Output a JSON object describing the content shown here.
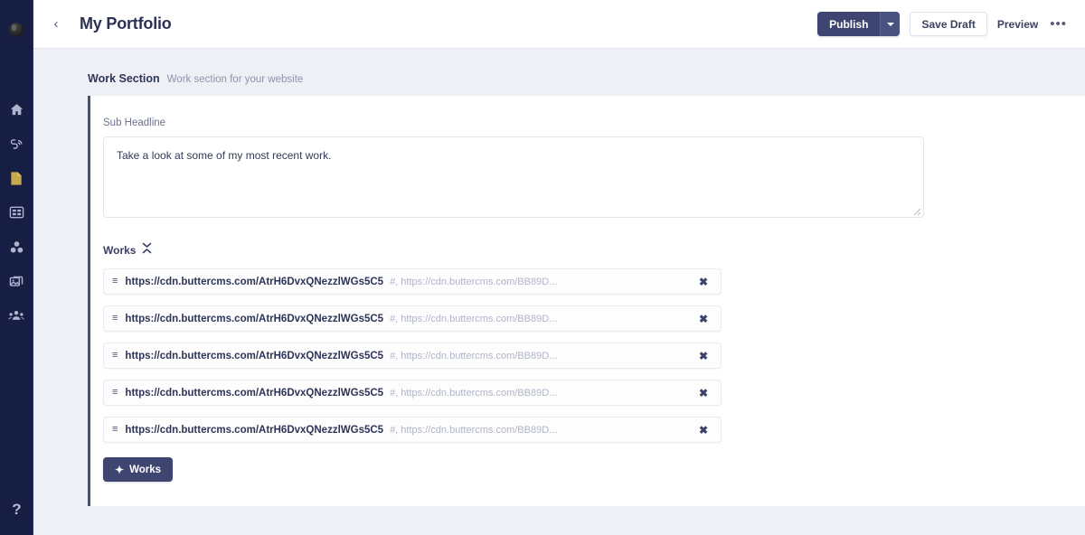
{
  "sidebar": {
    "avatar_name": "user-avatar",
    "items": [
      {
        "name": "home-icon",
        "label": "Home"
      },
      {
        "name": "blog-icon",
        "label": "Blog"
      },
      {
        "name": "pages-icon",
        "label": "Pages"
      },
      {
        "name": "collections-icon",
        "label": "Collections"
      },
      {
        "name": "components-icon",
        "label": "Components"
      },
      {
        "name": "media-icon",
        "label": "Media"
      },
      {
        "name": "team-icon",
        "label": "Team"
      }
    ],
    "help": {
      "label": "?",
      "name": "help-icon"
    }
  },
  "topbar": {
    "back_label": "‹",
    "title": "My Portfolio",
    "publish_label": "Publish",
    "publish_caret_name": "chevron-down-icon",
    "save_draft_label": "Save Draft",
    "preview_label": "Preview",
    "more_label": "•••"
  },
  "section": {
    "title": "Work Section",
    "subtitle": "Work section for your website"
  },
  "form": {
    "subheadline": {
      "label": "Sub Headline",
      "value": "Take a look at some of my most recent work.",
      "placeholder": "Sub Headline"
    },
    "works": {
      "label": "Works",
      "collapse_icon_name": "collapse-expand-icon",
      "add_button_label": "Works",
      "add_button_plus": "✦",
      "remove_glyph": "✖",
      "drag_glyph": "≡",
      "rows": [
        {
          "primary": "https://cdn.buttercms.com/AtrH6DvxQNezzlWGs5C5",
          "secondary": "#, https://cdn.buttercms.com/BB89D..."
        },
        {
          "primary": "https://cdn.buttercms.com/AtrH6DvxQNezzlWGs5C5",
          "secondary": "#, https://cdn.buttercms.com/BB89D..."
        },
        {
          "primary": "https://cdn.buttercms.com/AtrH6DvxQNezzlWGs5C5",
          "secondary": "#, https://cdn.buttercms.com/BB89D..."
        },
        {
          "primary": "https://cdn.buttercms.com/AtrH6DvxQNezzlWGs5C5",
          "secondary": "#, https://cdn.buttercms.com/BB89D..."
        },
        {
          "primary": "https://cdn.buttercms.com/AtrH6DvxQNezzlWGs5C5",
          "secondary": "#, https://cdn.buttercms.com/BB89D..."
        }
      ]
    }
  },
  "colors": {
    "sidebar_bg": "#161e44",
    "accent_dark": "#3d4570",
    "page_bg": "#eef0f6",
    "card_border": "#464e73",
    "pages_icon": "#c6a94a"
  }
}
